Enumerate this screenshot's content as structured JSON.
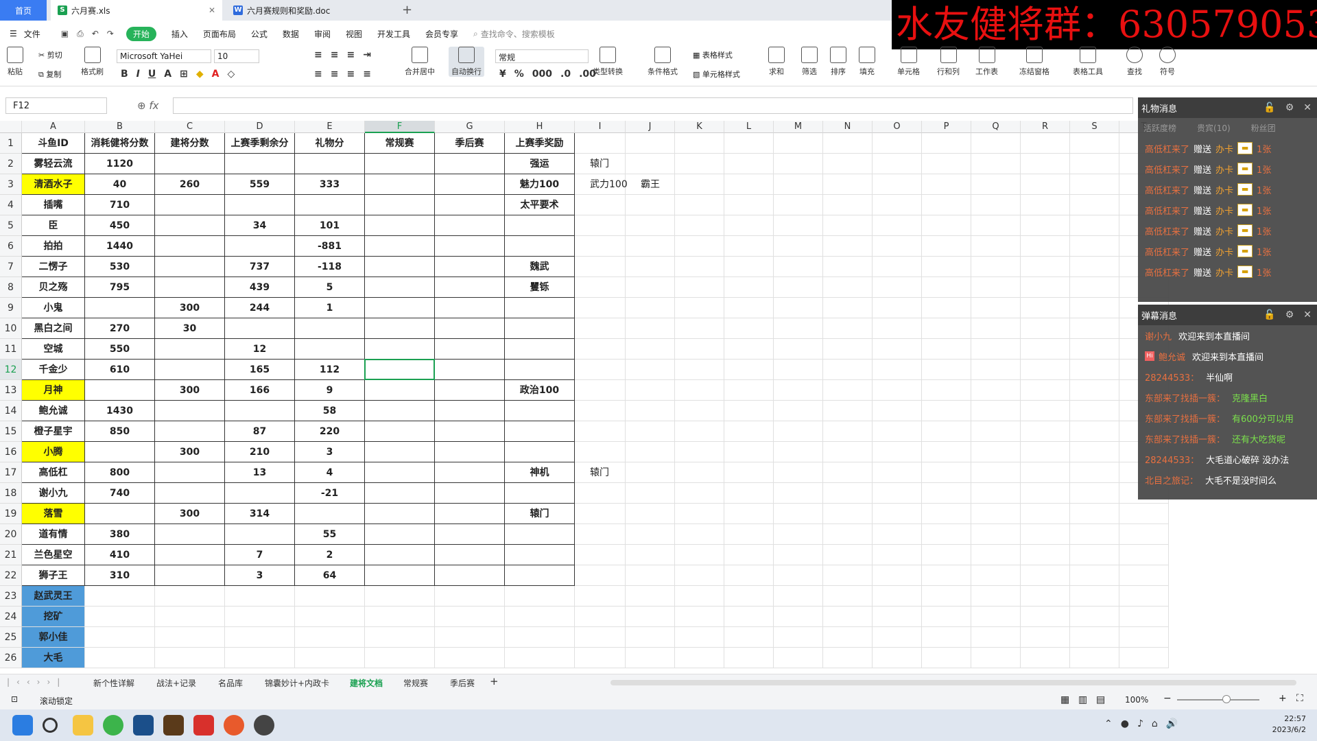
{
  "tabs": {
    "home": "首页",
    "active_file": "六月赛.xls",
    "doc_file": "六月赛规则和奖励.doc",
    "new_tab": "+"
  },
  "banner": "水友健将群：630579053",
  "menu": {
    "file": "文件",
    "items": [
      "开始",
      "插入",
      "页面布局",
      "公式",
      "数据",
      "审阅",
      "视图",
      "开发工具",
      "会员专享"
    ],
    "search": "查找命令、搜索模板"
  },
  "ribbon": {
    "paste": "粘贴",
    "cut": "剪切",
    "copy": "复制",
    "format_painter": "格式刷",
    "font": "Microsoft YaHei",
    "size": "10",
    "merge": "合并居中",
    "wrap": "自动换行",
    "number_format": "常规",
    "type_convert": "类型转换",
    "cond_format": "条件格式",
    "table_style": "表格样式",
    "cell_style": "单元格样式",
    "sum": "求和",
    "filter": "筛选",
    "sort": "排序",
    "fill": "填充",
    "cell": "单元格",
    "row_col": "行和列",
    "worksheet": "工作表",
    "freeze": "冻结窗格",
    "table_tools": "表格工具",
    "find": "查找",
    "symbol": "符号"
  },
  "formula_bar": {
    "name_box": "F12",
    "fx": "fx",
    "formula": ""
  },
  "columns": [
    "A",
    "B",
    "C",
    "D",
    "E",
    "F",
    "G",
    "H",
    "I",
    "J",
    "K",
    "L",
    "M",
    "N",
    "O",
    "P",
    "Q",
    "R",
    "S",
    "T"
  ],
  "header_row": [
    "斗鱼ID",
    "消耗健将分数",
    "建将分数",
    "上赛季剩余分",
    "礼物分",
    "常规赛",
    "季后赛",
    "上赛季奖励"
  ],
  "rows": [
    {
      "a": "雾轻云流",
      "b": "1120",
      "c": "",
      "d": "",
      "e": "",
      "h": "强运",
      "i": "辕门",
      "j": ""
    },
    {
      "a": "清酒水子",
      "b": "40",
      "c": "260",
      "d": "559",
      "e": "333",
      "h": "魅力100",
      "i": "武力100",
      "j": "霸王",
      "ya": true
    },
    {
      "a": "插嘴",
      "b": "710",
      "c": "",
      "d": "",
      "e": "",
      "h": "太平要术",
      "i": "",
      "j": ""
    },
    {
      "a": "臣",
      "b": "450",
      "c": "",
      "d": "34",
      "e": "101",
      "h": "",
      "i": "",
      "j": ""
    },
    {
      "a": "拍拍",
      "b": "1440",
      "c": "",
      "d": "",
      "e": "-881",
      "h": "",
      "i": "",
      "j": ""
    },
    {
      "a": "二愣子",
      "b": "530",
      "c": "",
      "d": "737",
      "e": "-118",
      "h": "魏武",
      "i": "",
      "j": ""
    },
    {
      "a": "贝之殇",
      "b": "795",
      "c": "",
      "d": "439",
      "e": "5",
      "h": "矍铄",
      "i": "",
      "j": ""
    },
    {
      "a": "小鬼",
      "b": "",
      "c": "300",
      "d": "244",
      "e": "1",
      "h": "",
      "i": "",
      "j": ""
    },
    {
      "a": "黑白之间",
      "b": "270",
      "c": "30",
      "d": "",
      "e": "",
      "h": "",
      "i": "",
      "j": ""
    },
    {
      "a": "空城",
      "b": "550",
      "c": "",
      "d": "12",
      "e": "",
      "h": "",
      "i": "",
      "j": ""
    },
    {
      "a": "千金少",
      "b": "610",
      "c": "",
      "d": "165",
      "e": "112",
      "h": "",
      "i": "",
      "j": ""
    },
    {
      "a": "月神",
      "b": "",
      "c": "300",
      "d": "166",
      "e": "9",
      "h": "政治100",
      "i": "",
      "j": "",
      "ya": true
    },
    {
      "a": "鲍允诚",
      "b": "1430",
      "c": "",
      "d": "",
      "e": "58",
      "h": "",
      "i": "",
      "j": ""
    },
    {
      "a": "橙子星宇",
      "b": "850",
      "c": "",
      "d": "87",
      "e": "220",
      "h": "",
      "i": "",
      "j": ""
    },
    {
      "a": "小腾",
      "b": "",
      "c": "300",
      "d": "210",
      "e": "3",
      "h": "",
      "i": "",
      "j": "",
      "ya": true
    },
    {
      "a": "高低杠",
      "b": "800",
      "c": "",
      "d": "13",
      "e": "4",
      "h": "神机",
      "i": "辕门",
      "j": ""
    },
    {
      "a": "谢小九",
      "b": "740",
      "c": "",
      "d": "",
      "e": "-21",
      "h": "",
      "i": "",
      "j": ""
    },
    {
      "a": "落雪",
      "b": "",
      "c": "300",
      "d": "314",
      "e": "",
      "h": "辕门",
      "i": "",
      "j": "",
      "ya": true
    },
    {
      "a": "道有情",
      "b": "380",
      "c": "",
      "d": "",
      "e": "55",
      "h": "",
      "i": "",
      "j": ""
    },
    {
      "a": "兰色星空",
      "b": "410",
      "c": "",
      "d": "7",
      "e": "2",
      "h": "",
      "i": "",
      "j": ""
    },
    {
      "a": "狮子王",
      "b": "310",
      "c": "",
      "d": "3",
      "e": "64",
      "h": "",
      "i": "",
      "j": ""
    }
  ],
  "extra_rows": [
    "赵武灵王",
    "挖矿",
    "郭小佳",
    "大毛"
  ],
  "row_numbers": [
    "1",
    "2",
    "3",
    "4",
    "5",
    "6",
    "7",
    "8",
    "9",
    "10",
    "11",
    "12",
    "13",
    "14",
    "15",
    "16",
    "17",
    "18",
    "19",
    "20",
    "21",
    "22",
    "23",
    "24",
    "25",
    "26"
  ],
  "gift_panel": {
    "title": "礼物消息",
    "tabs": [
      "活跃度榜",
      "贵宾(10)",
      "粉丝团"
    ],
    "sender": "高低杠来了",
    "verb": "赠送",
    "item": "办卡",
    "count": "1张",
    "repeat": 7
  },
  "chat_panel": {
    "title": "弹幕消息",
    "messages": [
      {
        "user": "谢小九",
        "text": "欢迎来到本直播间",
        "color": "white"
      },
      {
        "user": "鲍允诚",
        "text": "欢迎来到本直播间",
        "color": "white",
        "badge": "Hi"
      },
      {
        "user": "28244533：",
        "text": "半仙啊",
        "color": "white"
      },
      {
        "user": "东部来了找插一簇：",
        "text": "克隆黑白",
        "color": "green"
      },
      {
        "user": "东部来了找插一簇：",
        "text": "有600分可以用",
        "color": "green"
      },
      {
        "user": "东部来了找插一簇：",
        "text": "还有大吃货呢",
        "color": "green"
      },
      {
        "user": "28244533：",
        "text": "大毛道心破碎 没办法",
        "color": "white"
      },
      {
        "user": "北目之旅记：",
        "text": "大毛不是没时间么",
        "color": "white"
      }
    ]
  },
  "sheets": [
    "新个性详解",
    "战法+记录",
    "名品库",
    "锦囊妙计+内政卡",
    "建将文档",
    "常规赛",
    "季后赛"
  ],
  "active_sheet": "建将文档",
  "status": {
    "scroll_lock": "滚动锁定",
    "zoom": "100%"
  },
  "clock": {
    "time": "22:57",
    "date": "2023/6/2"
  }
}
